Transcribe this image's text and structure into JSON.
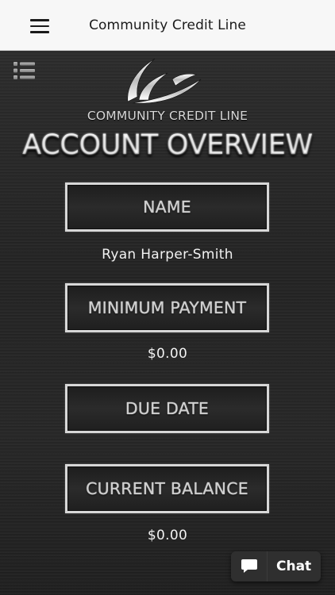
{
  "header": {
    "title": "Community Credit Line"
  },
  "brand": {
    "name": "COMMUNITY CREDIT LINE"
  },
  "page": {
    "heading": "ACCOUNT OVERVIEW"
  },
  "fields": [
    {
      "label": "NAME",
      "value": "Ryan Harper-Smith"
    },
    {
      "label": "MINIMUM PAYMENT",
      "value": "$0.00"
    },
    {
      "label": "DUE DATE",
      "value": ""
    },
    {
      "label": "CURRENT BALANCE",
      "value": "$0.00"
    }
  ],
  "chat": {
    "label": "Chat"
  },
  "icons": {
    "menu": "hamburger-menu-icon",
    "list": "list-icon",
    "logo": "swoosh-logo",
    "chat": "speech-bubble-icon"
  },
  "colors": {
    "top_bar_bg": "#f7f7f7",
    "content_bg": "#262626",
    "box_border": "#d7d7d7",
    "text_light": "#f2f2f2",
    "chat_bg": "#2f2f2f"
  }
}
